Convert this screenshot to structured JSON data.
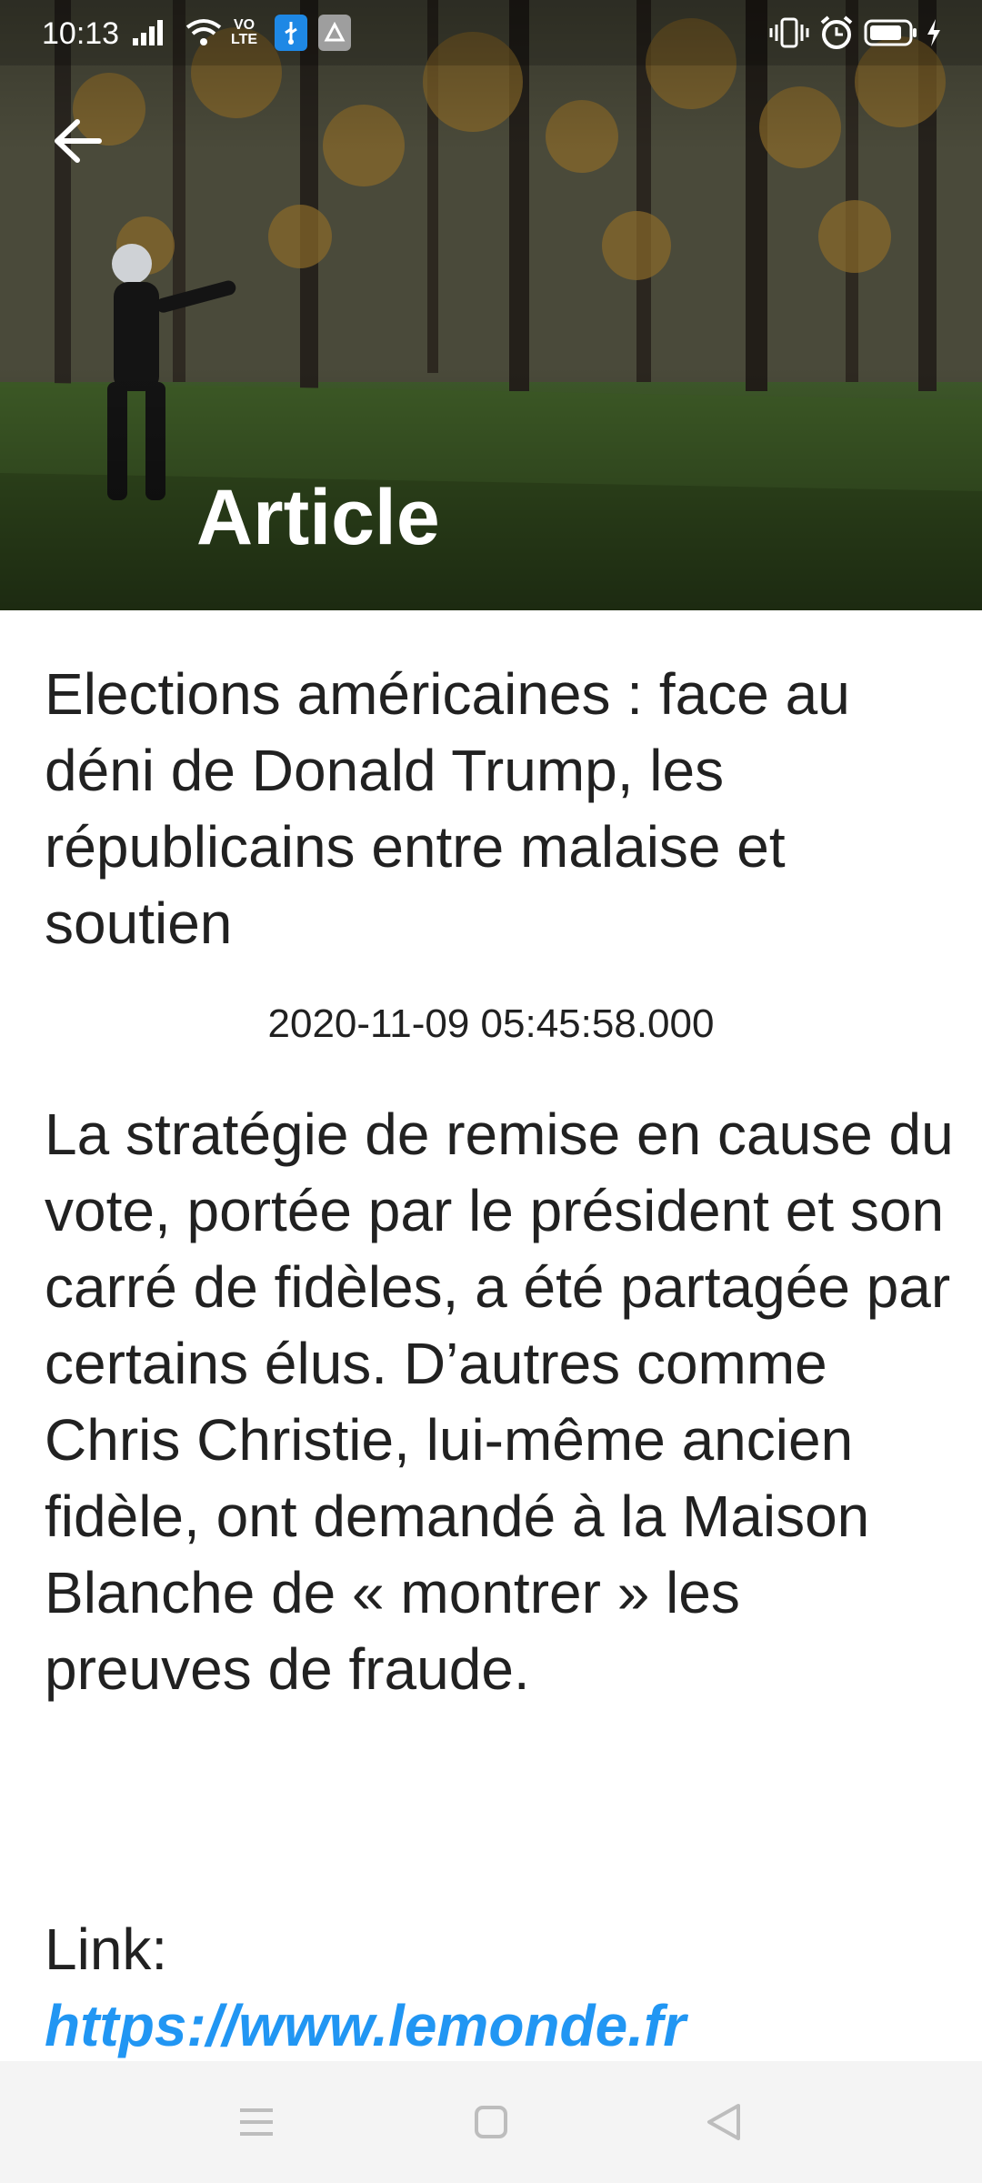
{
  "status_bar": {
    "time": "10:13",
    "indicators": [
      "signal-icon",
      "wifi-icon",
      "volte-icon",
      "usb-icon",
      "app-notification-icon",
      "vibrate-icon",
      "alarm-icon",
      "battery-icon",
      "charging-icon"
    ]
  },
  "header": {
    "title": "Article",
    "back_icon": "arrow-left-icon"
  },
  "article": {
    "title": "Elections américaines : face au déni de Donald Trump, les républicains entre malaise et soutien",
    "date": "2020-11-09 05:45:58.000",
    "body": "La stratégie de remise en cause du vote, portée par le président et son carré de fidèles, a été partagée par certains élus. D’autres comme Chris Christie, lui-même ancien fidèle, ont demandé à la Maison Blanche de « montrer » les preuves de fraude.",
    "link_label": "Link:",
    "link_url": "https://www.lemonde.fr"
  },
  "navigation": {
    "buttons": [
      "menu-icon",
      "home-icon",
      "back-triangle-icon"
    ]
  },
  "colors": {
    "link": "#2196f3",
    "text": "#212121",
    "nav_bg": "#f4f4f4"
  }
}
